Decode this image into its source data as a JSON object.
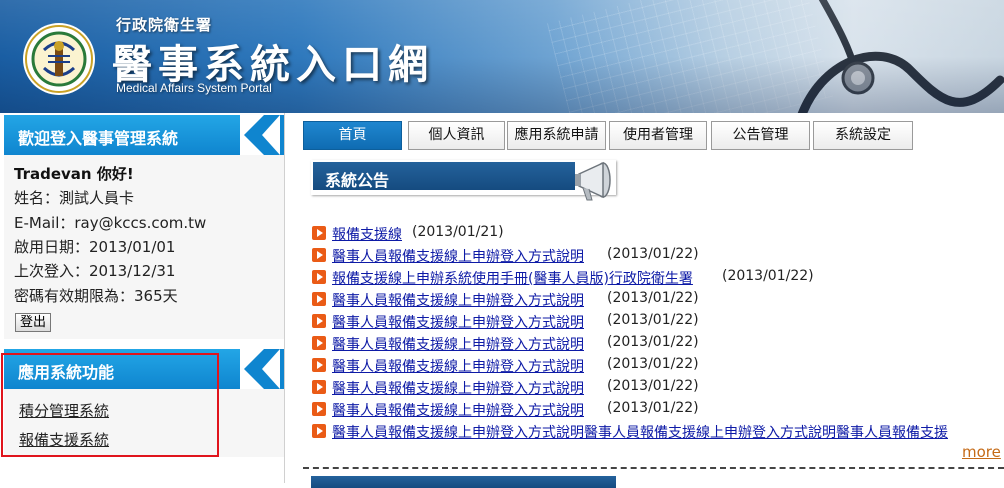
{
  "header": {
    "ministry": "行政院衛生署",
    "title": "醫事系統入口網",
    "subtitle": "Medical Affairs System Portal"
  },
  "sidebar": {
    "welcome_title": "歡迎登入醫事管理系統",
    "greeting": "Tradevan 你好!",
    "info": [
      "姓名：測試人員卡",
      "E-Mail：ray@kccs.com.tw",
      "啟用日期：2013/01/01",
      "上次登入：2013/12/31",
      "密碼有效期限為：365天"
    ],
    "logout_label": "登出",
    "functions_title": "應用系統功能",
    "functions": [
      "積分管理系統",
      "報備支援系統"
    ]
  },
  "nav": {
    "tabs": [
      "首頁",
      "個人資訊",
      "應用系統申請",
      "使用者管理",
      "公告管理",
      "系統設定"
    ],
    "active_index": 0
  },
  "announcements": {
    "title": "系統公告",
    "items": [
      {
        "title": "報備支援線",
        "date": "(2013/01/21)"
      },
      {
        "title": "醫事人員報備支援線上申辦登入方式說明",
        "date": "(2013/01/22)"
      },
      {
        "title": "報備支援線上申辦系統使用手冊(醫事人員版)行政院衛生署",
        "date": "(2013/01/22)"
      },
      {
        "title": "醫事人員報備支援線上申辦登入方式說明",
        "date": "(2013/01/22)"
      },
      {
        "title": "醫事人員報備支援線上申辦登入方式說明",
        "date": "(2013/01/22)"
      },
      {
        "title": "醫事人員報備支援線上申辦登入方式說明",
        "date": "(2013/01/22)"
      },
      {
        "title": "醫事人員報備支援線上申辦登入方式說明",
        "date": "(2013/01/22)"
      },
      {
        "title": "醫事人員報備支援線上申辦登入方式說明",
        "date": "(2013/01/22)"
      },
      {
        "title": "醫事人員報備支援線上申辦登入方式說明",
        "date": "(2013/01/22)"
      },
      {
        "title": "醫事人員報備支援線上申辦登入方式說明醫事人員報備支援線上申辦登入方式說明醫事人員報備支援",
        "date": ""
      }
    ],
    "more_label": "more"
  },
  "colors": {
    "accent_blue": "#0f85cf",
    "nav_active": "#1f86cf",
    "link": "#0d1aa6",
    "bullet": "#ea5b16",
    "highlight_border": "#e0141c"
  }
}
